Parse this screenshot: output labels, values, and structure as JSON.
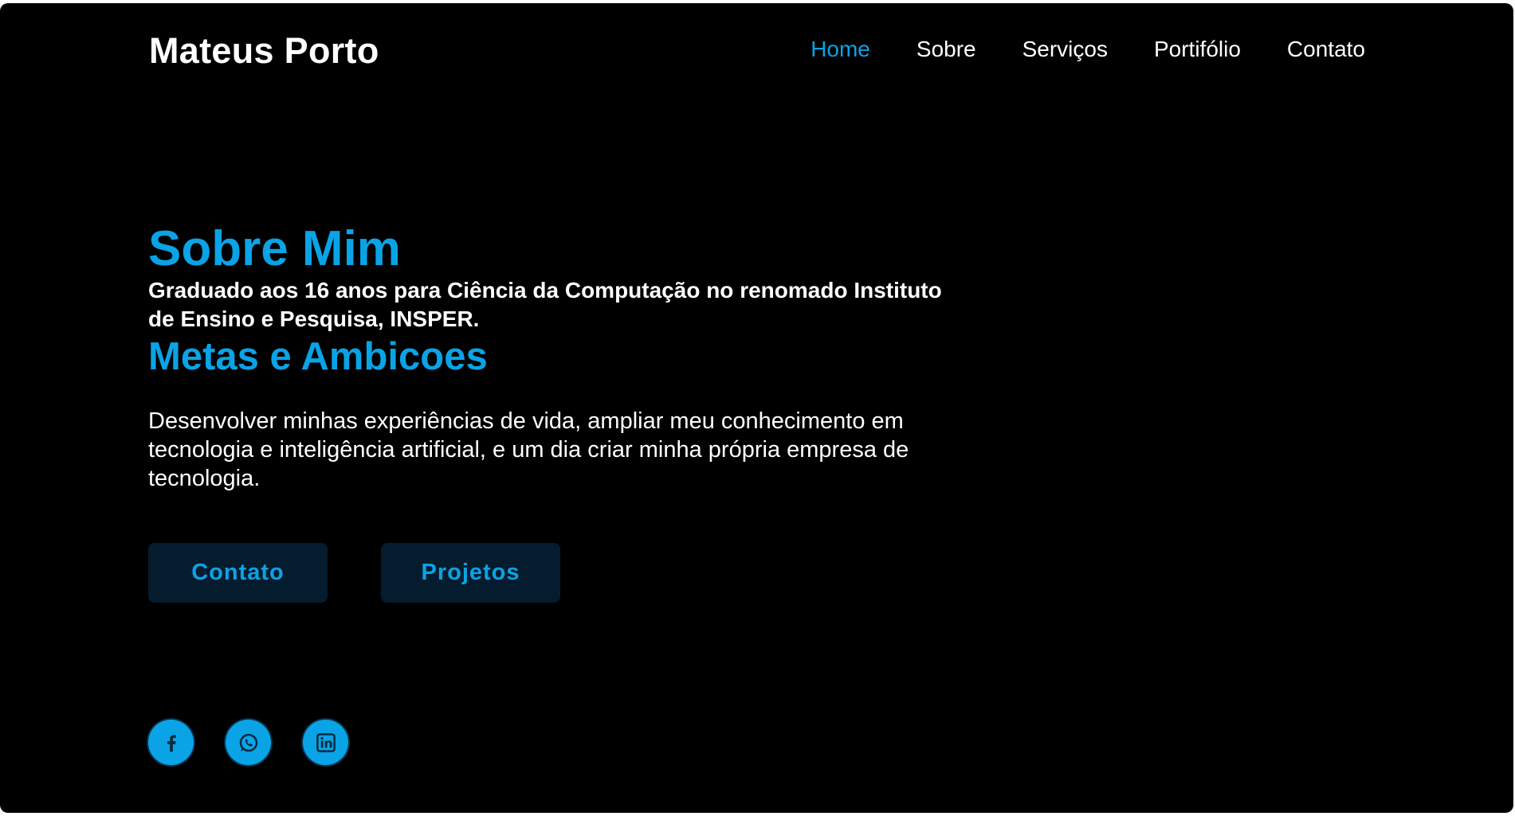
{
  "header": {
    "brand": "Mateus Porto",
    "nav": [
      {
        "label": "Home",
        "active": true
      },
      {
        "label": "Sobre",
        "active": false
      },
      {
        "label": "Serviços",
        "active": false
      },
      {
        "label": "Portifólio",
        "active": false
      },
      {
        "label": "Contato",
        "active": false
      }
    ]
  },
  "main": {
    "title": "Sobre Mim",
    "lead": "Graduado aos 16 anos para Ciência da Computação no renomado Instituto de Ensino e Pesquisa, INSPER.",
    "subtitle": "Metas e Ambicoes",
    "paragraph": "Desenvolver minhas experiências de vida, ampliar meu conhecimento em tecnologia e inteligência artificial, e um dia criar minha própria empresa de tecnologia.",
    "buttons": {
      "contact_label": "Contato",
      "projects_label": "Projetos"
    }
  },
  "socials": [
    {
      "icon": "facebook-icon"
    },
    {
      "icon": "whatsapp-icon"
    },
    {
      "icon": "linkedin-icon"
    }
  ],
  "colors": {
    "accent": "#0aa3e6",
    "background": "#000000",
    "button_bg": "#051c2e",
    "text": "#ffffff"
  }
}
